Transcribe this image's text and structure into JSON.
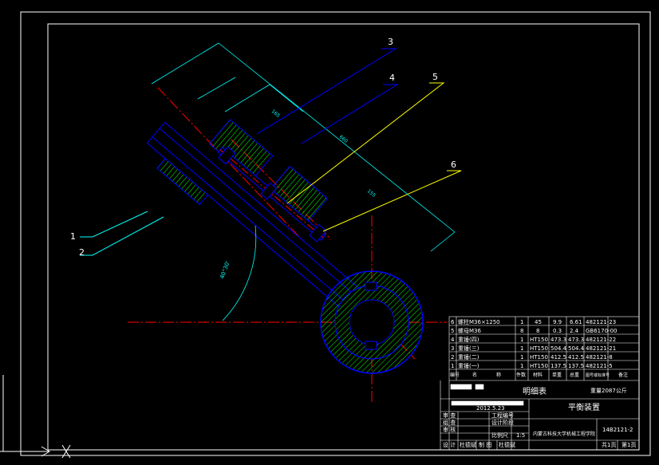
{
  "callouts": [
    {
      "num": "1"
    },
    {
      "num": "2"
    },
    {
      "num": "3"
    },
    {
      "num": "4"
    },
    {
      "num": "5"
    },
    {
      "num": "6"
    }
  ],
  "angle_label": "40°30'",
  "bom": {
    "rows": [
      {
        "no": "6",
        "name": "螺柱M36×1250",
        "qty": "1",
        "mat": "45",
        "w1": "9.9",
        "w2": "6.61",
        "code": "482121-23"
      },
      {
        "no": "5",
        "name": "螺母M36",
        "qty": "8",
        "mat": "8",
        "w1": "0.3",
        "w2": "2.4",
        "code": "GB6170-00"
      },
      {
        "no": "4",
        "name": "重锤(四)",
        "qty": "1",
        "mat": "HT150",
        "w1": "473.3",
        "w2": "473.3",
        "code": "482121-22"
      },
      {
        "no": "3",
        "name": "重锤(三)",
        "qty": "1",
        "mat": "HT150",
        "w1": "504.4",
        "w2": "504.4",
        "code": "482121-21"
      },
      {
        "no": "2",
        "name": "重锤(二)",
        "qty": "1",
        "mat": "HT150",
        "w1": "412.5",
        "w2": "412.5",
        "code": "482121-8"
      },
      {
        "no": "1",
        "name": "重锤(一)",
        "qty": "1",
        "mat": "HT150",
        "w1": "137.5",
        "w2": "137.5",
        "code": "482121-5"
      }
    ],
    "header": {
      "no": "编号",
      "name": "名",
      "name2": "称",
      "qty": "件数",
      "mat": "材料",
      "w1": "单重",
      "w2": "总重",
      "code": "图号或标准号",
      "note": "备注"
    },
    "title": "明细表",
    "total_weight": "重量2087公斤"
  },
  "title_block": {
    "date": "2012.5.23",
    "drawing_title": "平衡装置",
    "drawing_no": "14B2121-2",
    "project_no": "工程编号",
    "stage": "设计阶段",
    "scale_label": "比例尺",
    "scale": "1:5",
    "org": "内蒙古科技大学机械工程学院",
    "sheets_total": "共1页",
    "sheet_no": "第1页",
    "roles": [
      "审 查",
      "组 查",
      "审 核",
      "设 计"
    ],
    "designer_name": "杜德斌",
    "drafter_label": "制 图",
    "drafter_name": "杜德斌"
  },
  "colors": {
    "background": "#000000",
    "frame": "#ffffff",
    "part_outline": "#0000ff",
    "hatch": "#00ff00",
    "leader_yellow": "#ffff00",
    "leader_cyan": "#00ffff",
    "dimension": "#00ffff",
    "centerline": "#ff0000"
  }
}
